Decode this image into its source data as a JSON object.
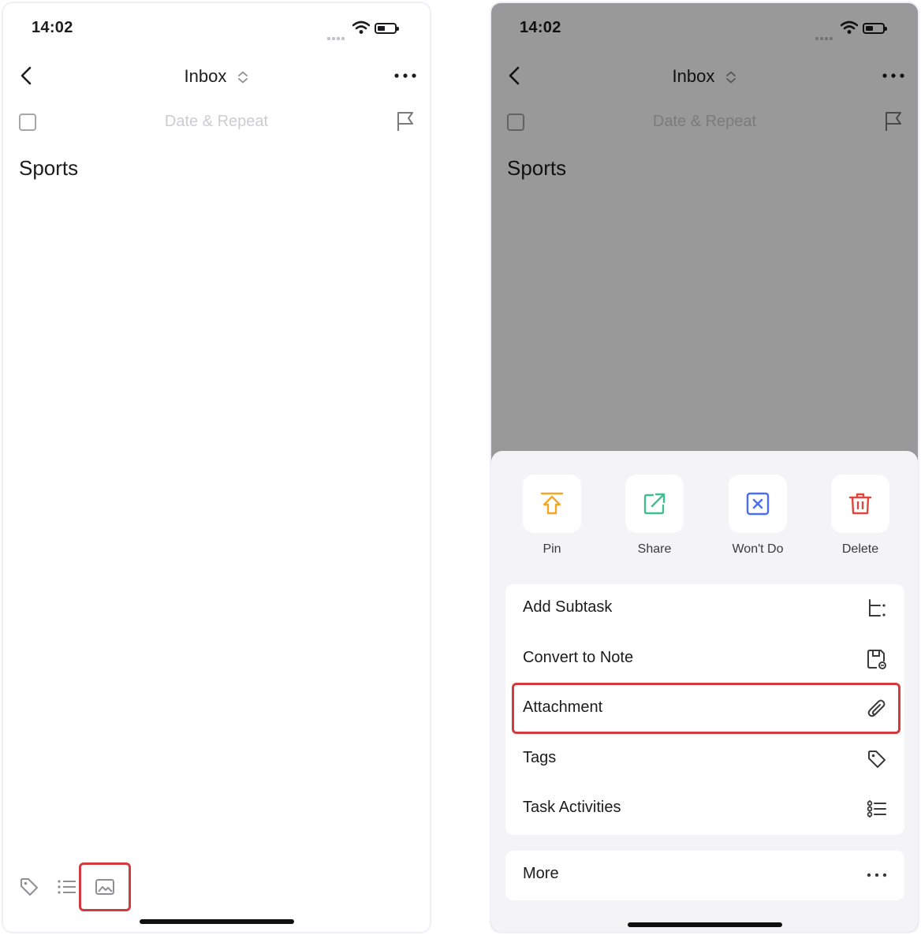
{
  "left_phone": {
    "status": {
      "time": "14:02"
    },
    "nav": {
      "title": "Inbox"
    },
    "task": {
      "date_placeholder": "Date & Repeat",
      "title": "Sports"
    },
    "toolbar": {
      "icons": [
        "tag-icon",
        "list-icon",
        "image-icon"
      ],
      "highlighted": "image-icon"
    }
  },
  "right_phone": {
    "status": {
      "time": "14:02"
    },
    "nav": {
      "title": "Inbox"
    },
    "task": {
      "date_placeholder": "Date & Repeat",
      "title": "Sports"
    },
    "actions": [
      {
        "label": "Pin",
        "icon": "pin-icon",
        "color": "#f5a623"
      },
      {
        "label": "Share",
        "icon": "share-icon",
        "color": "#3dbf8f"
      },
      {
        "label": "Won't Do",
        "icon": "wont-do-icon",
        "color": "#4a6cf7"
      },
      {
        "label": "Delete",
        "icon": "trash-icon",
        "color": "#e0453e"
      }
    ],
    "menu": [
      {
        "label": "Add Subtask",
        "icon": "subtask-icon"
      },
      {
        "label": "Convert to Note",
        "icon": "note-icon"
      },
      {
        "label": "Attachment",
        "icon": "paperclip-icon"
      },
      {
        "label": "Tags",
        "icon": "tag-icon"
      },
      {
        "label": "Task Activities",
        "icon": "activity-icon"
      }
    ],
    "highlighted_menu_item": "Attachment",
    "more": {
      "label": "More",
      "icon": "more-icon"
    }
  },
  "colors": {
    "highlight": "#d33a3f",
    "text": "#1c1c1e",
    "muted": "#cdcdd1",
    "sheet_bg": "#f4f4f6"
  }
}
